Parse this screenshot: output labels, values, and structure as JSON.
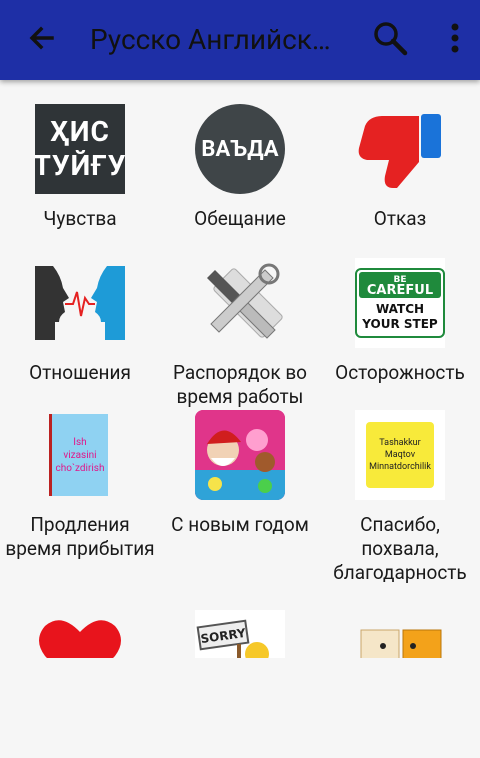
{
  "appbar": {
    "title": "Русско Английск…",
    "colors": {
      "background": "#1e2fa6",
      "title": "#111111"
    },
    "icons": [
      "back-arrow-icon",
      "search-icon",
      "more-vert-icon"
    ]
  },
  "tiles": [
    {
      "label": "Чувства",
      "thumb_lines": [
        "ҲИС",
        "ТУЙҒУ"
      ]
    },
    {
      "label": "Обещание",
      "thumb_text": "ВАЪДА"
    },
    {
      "label": "Отказ",
      "icon": "thumbs-down-icon"
    },
    {
      "label": "Отношения",
      "icon": "dialog-faces-icon"
    },
    {
      "label": "Распорядок во время работы",
      "icon": "tools-icon"
    },
    {
      "label": "Осторожность",
      "sign_lines": [
        "BE",
        "CAREFUL",
        "WATCH",
        "YOUR STEP"
      ]
    },
    {
      "label": "Продления время прибытия",
      "card_lines": [
        "Ish",
        "vizasini",
        "cho`zdirish"
      ]
    },
    {
      "label": "С новым годом",
      "icon": "new-year-game-icon"
    },
    {
      "label": "Спасибо, похвала, благодарность",
      "note_lines": [
        "Tashakkur",
        "Maqtov",
        "Minnatdorchilik"
      ]
    },
    {
      "label": "",
      "icon": "red-heart-icon"
    },
    {
      "label": "",
      "sign_text": "SORRY"
    },
    {
      "label": "",
      "icon": "two-cards-icon"
    }
  ]
}
